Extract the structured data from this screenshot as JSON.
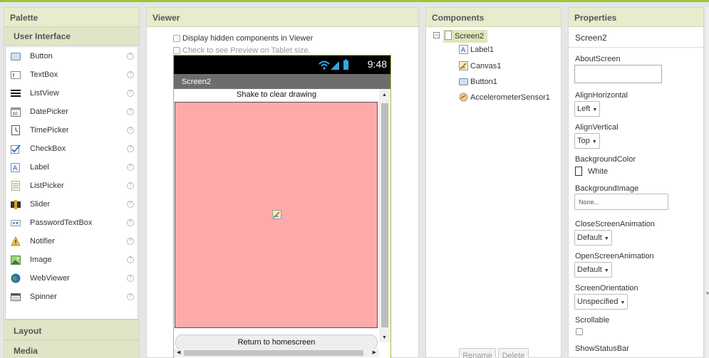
{
  "palette": {
    "title": "Palette",
    "group_open": "User Interface",
    "items": [
      {
        "label": "Button",
        "icon": "button-icon"
      },
      {
        "label": "TextBox",
        "icon": "textbox-icon"
      },
      {
        "label": "ListView",
        "icon": "listview-icon"
      },
      {
        "label": "DatePicker",
        "icon": "datepicker-icon"
      },
      {
        "label": "TimePicker",
        "icon": "timepicker-icon"
      },
      {
        "label": "CheckBox",
        "icon": "checkbox-icon"
      },
      {
        "label": "Label",
        "icon": "label-icon"
      },
      {
        "label": "ListPicker",
        "icon": "listpicker-icon"
      },
      {
        "label": "Slider",
        "icon": "slider-icon"
      },
      {
        "label": "PasswordTextBox",
        "icon": "password-icon"
      },
      {
        "label": "Notifier",
        "icon": "notifier-icon"
      },
      {
        "label": "Image",
        "icon": "image-icon"
      },
      {
        "label": "WebViewer",
        "icon": "webviewer-icon"
      },
      {
        "label": "Spinner",
        "icon": "spinner-icon"
      }
    ],
    "help_glyph": "?",
    "groups_collapsed": [
      "Layout",
      "Media"
    ]
  },
  "viewer": {
    "title": "Viewer",
    "display_hidden": "Display hidden components in Viewer",
    "tablet_preview": "Check to see Preview on Tablet size.",
    "status_time": "9:48",
    "screen_title": "Screen2",
    "shake_label": "Shake to clear drawing",
    "home_button": "Return to homescreen",
    "canvas_color": "#ffaaaa"
  },
  "components": {
    "title": "Components",
    "root": "Screen2",
    "children": [
      "Label1",
      "Canvas1",
      "Button1",
      "AccelerometerSensor1"
    ],
    "rename": "Rename",
    "delete": "Delete"
  },
  "properties": {
    "title": "Properties",
    "subject": "Screen2",
    "about_screen": "AboutScreen",
    "align_horizontal": "AlignHorizontal",
    "align_horizontal_value": "Left",
    "align_vertical": "AlignVertical",
    "align_vertical_value": "Top",
    "background_color": "BackgroundColor",
    "background_color_value": "White",
    "background_image": "BackgroundImage",
    "background_image_value": "None...",
    "close_anim": "CloseScreenAnimation",
    "close_anim_value": "Default",
    "open_anim": "OpenScreenAnimation",
    "open_anim_value": "Default",
    "orientation": "ScreenOrientation",
    "orientation_value": "Unspecified",
    "scrollable": "Scrollable",
    "show_status_bar": "ShowStatusBar"
  },
  "colors": {
    "accent_green": "#9ec43a",
    "header_bg": "#e6eccd",
    "selected_bg": "#dfe6b9"
  }
}
